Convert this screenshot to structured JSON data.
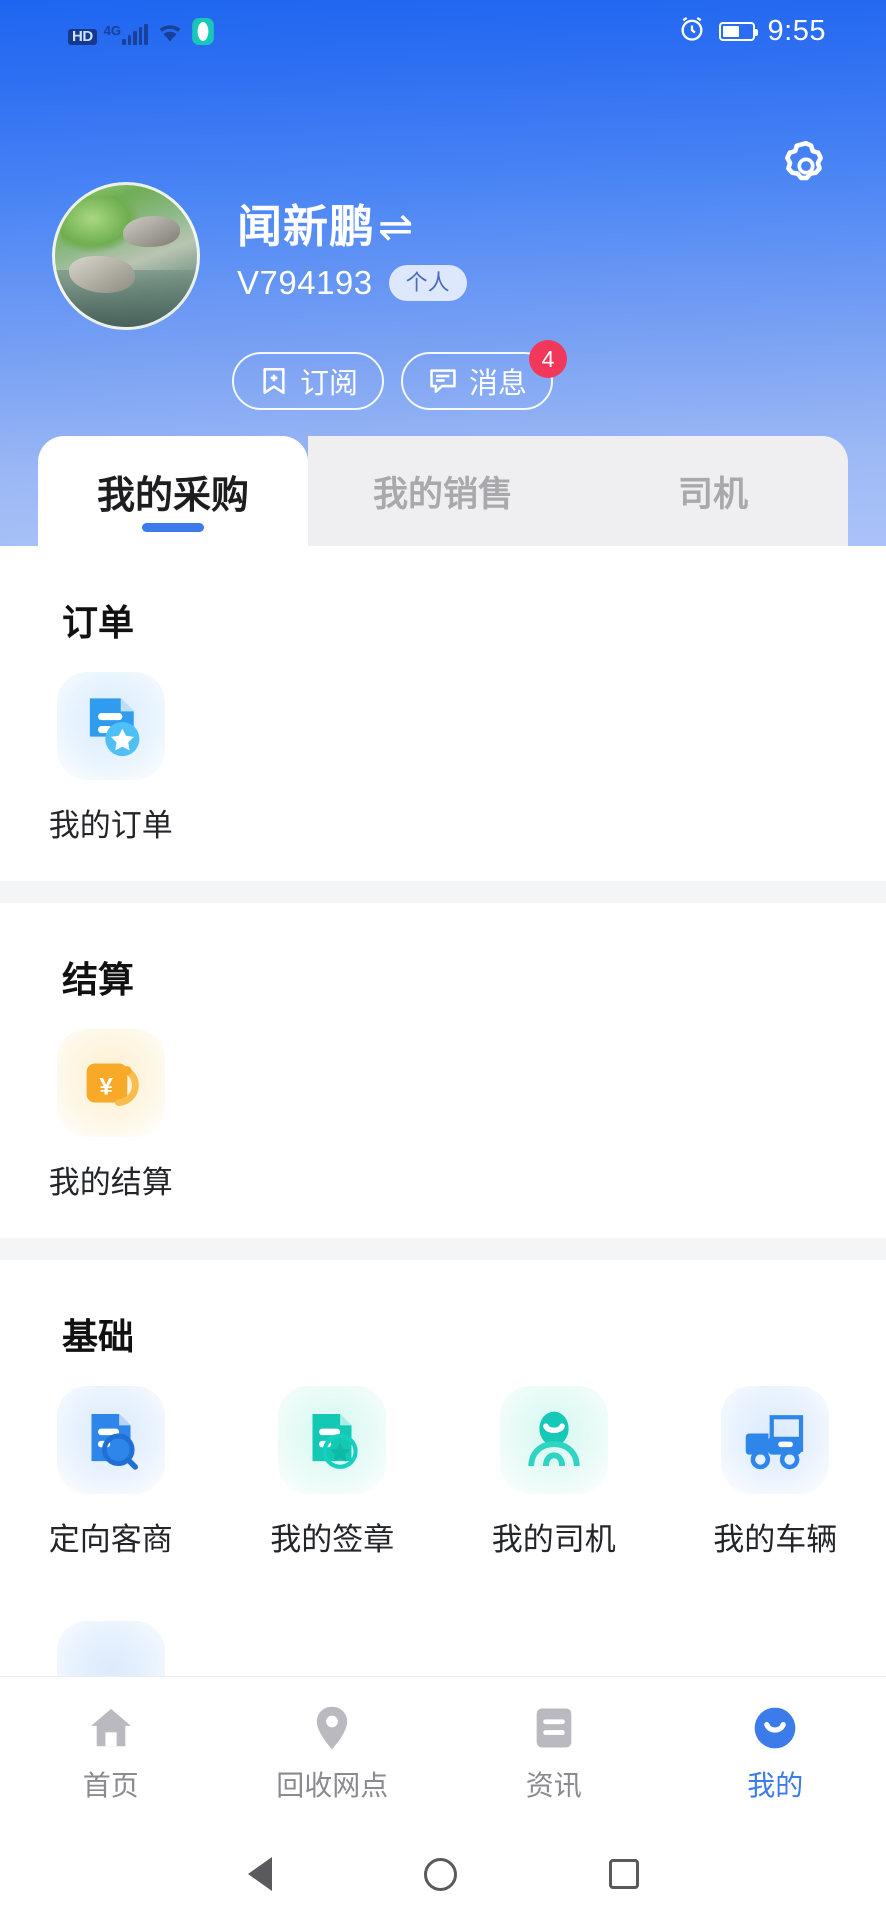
{
  "status_bar": {
    "hd_label": "HD",
    "network_label": "4G",
    "time": "9:55",
    "icons": [
      "hd-icon",
      "signal-icon",
      "wifi-icon",
      "vpn-icon",
      "alarm-icon",
      "battery-icon"
    ]
  },
  "header": {
    "settings_icon": "gear-icon",
    "accent_color": "#3b7bea"
  },
  "profile": {
    "avatar_name": "avatar",
    "name": "闻新鹏",
    "switch_icon": "⇌",
    "user_id": "V794193",
    "account_type": "个人",
    "actions": [
      {
        "label": "订阅",
        "icon": "bookmark-plus-icon",
        "badge": null
      },
      {
        "label": "消息",
        "icon": "chat-bubble-icon",
        "badge": "4"
      }
    ]
  },
  "tabs": [
    {
      "label": "我的采购",
      "active": true
    },
    {
      "label": "我的销售",
      "active": false
    },
    {
      "label": "司机",
      "active": false
    }
  ],
  "sections": [
    {
      "title": "订单",
      "items": [
        {
          "label": "我的订单",
          "icon": "document-star-icon",
          "color": "#35a8f4"
        }
      ]
    },
    {
      "title": "结算",
      "items": [
        {
          "label": "我的结算",
          "icon": "wallet-yuan-icon",
          "color": "#f5a623"
        }
      ]
    },
    {
      "title": "基础",
      "items": [
        {
          "label": "定向客商",
          "icon": "document-search-icon",
          "color": "#2b86ea"
        },
        {
          "label": "我的签章",
          "icon": "document-seal-star-icon",
          "color": "#14c9b8"
        },
        {
          "label": "我的司机",
          "icon": "driver-person-icon",
          "color": "#17c7b6"
        },
        {
          "label": "我的车辆",
          "icon": "truck-icon",
          "color": "#2b86ea"
        }
      ]
    }
  ],
  "bottom_nav": [
    {
      "label": "首页",
      "icon": "home-icon",
      "active": false
    },
    {
      "label": "回收网点",
      "icon": "location-pin-icon",
      "active": false
    },
    {
      "label": "资讯",
      "icon": "news-icon",
      "active": false
    },
    {
      "label": "我的",
      "icon": "profile-icon",
      "active": true
    }
  ],
  "android_nav": {
    "back": "back-triangle-icon",
    "home": "home-circle-icon",
    "recents": "recents-square-icon"
  }
}
